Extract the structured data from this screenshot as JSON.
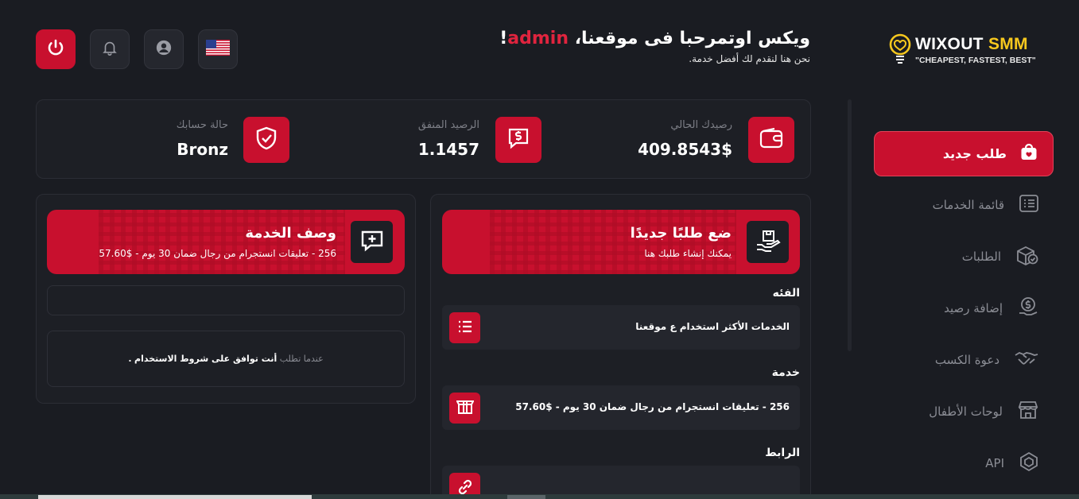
{
  "header": {
    "greeting_prefix": "ويكس اوتمرحبا فى موقعنا،",
    "greeting_user": "admin",
    "greeting_suffix": "!",
    "subtitle": "نحن هنا لنقدم لك أفضل خدمة."
  },
  "logo": {
    "name_part1": "WIXOUT",
    "name_part2": "SMM",
    "tagline": "\"CHEAPEST, FASTEST, BEST\""
  },
  "top_buttons": {
    "power_icon": "power-icon",
    "bell_icon": "bell-icon",
    "user_icon": "user-icon",
    "flag_icon": "us-flag-icon"
  },
  "sidebar": {
    "items": [
      {
        "label": "طلب جديد",
        "icon": "cart-icon",
        "active": true
      },
      {
        "label": "قائمة الخدمات",
        "icon": "list-icon"
      },
      {
        "label": "الطلبات",
        "icon": "box-check-icon"
      },
      {
        "label": "إضافة رصيد",
        "icon": "money-icon"
      },
      {
        "label": "دعوة الكسب",
        "icon": "handshake-icon"
      },
      {
        "label": "لوحات الأطفال",
        "icon": "store-icon"
      },
      {
        "label": "API",
        "icon": "api-icon"
      }
    ]
  },
  "stats": {
    "balance_label": "رصيدك الحالي",
    "balance_value": "409.8543$",
    "spent_label": "الرصيد المنفق",
    "spent_value": "1.1457",
    "status_label": "حالة حسابك",
    "status_value": "Bronz"
  },
  "order_panel": {
    "title": "ضع طلبًا جديدًا",
    "subtitle": "يمكنك إنشاء طلبك هنا",
    "category_label": "الفئه",
    "category_value": "الخدمات الأكثر استخدام ع موقعنا",
    "service_label": "خدمة",
    "service_value": "256 - تعليقات انستجرام من رجال ضمان 30 يوم - $57.60",
    "link_label": "الرابط"
  },
  "description_panel": {
    "title": "وصف الخدمة",
    "subtitle": "256 - تعليقات انستجرام من رجال ضمان 30 يوم - $57.60",
    "terms_prefix": "عندما تطلب",
    "terms_bold": "أنت توافق على شروط الاستخدام",
    "terms_suffix": "."
  },
  "colors": {
    "accent": "#c8102e",
    "background": "#1a1c22",
    "card": "#1d1f25",
    "logo_yellow": "#f7c81e"
  }
}
